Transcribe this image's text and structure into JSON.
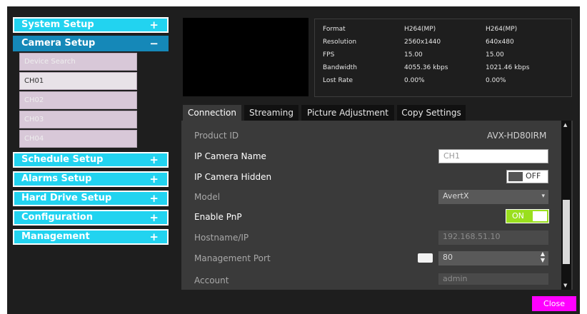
{
  "sidebar": {
    "sections": [
      {
        "label": "System Setup",
        "icon": "+"
      },
      {
        "label": "Camera Setup",
        "icon": "−"
      },
      {
        "label": "Schedule Setup",
        "icon": "+"
      },
      {
        "label": "Alarms Setup",
        "icon": "+"
      },
      {
        "label": "Hard Drive Setup",
        "icon": "+"
      },
      {
        "label": "Configuration",
        "icon": "+"
      },
      {
        "label": "Management",
        "icon": "+"
      }
    ],
    "camera_items": [
      "Device Search",
      "CH01",
      "CH02",
      "CH03",
      "CH04"
    ],
    "selected_item": "CH01"
  },
  "stats": {
    "rows": [
      {
        "label": "Format",
        "main": "H264(MP)",
        "sub": "H264(MP)"
      },
      {
        "label": "Resolution",
        "main": "2560x1440",
        "sub": "640x480"
      },
      {
        "label": "FPS",
        "main": "15.00",
        "sub": "15.00"
      },
      {
        "label": "Bandwidth",
        "main": "4055.36 kbps",
        "sub": "1021.46 kbps"
      },
      {
        "label": "Lost Rate",
        "main": "0.00%",
        "sub": "0.00%"
      }
    ]
  },
  "tabs": [
    "Connection",
    "Streaming",
    "Picture Adjustment",
    "Copy Settings"
  ],
  "active_tab": "Connection",
  "form": {
    "product_id_label": "Product ID",
    "product_id_value": "AVX-HD80IRM",
    "camera_name_label": "IP Camera Name",
    "camera_name_value": "CH1",
    "hidden_label": "IP Camera Hidden",
    "hidden_toggle": "OFF",
    "model_label": "Model",
    "model_value": "AvertX",
    "pnp_label": "Enable PnP",
    "pnp_toggle": "ON",
    "hostname_label": "Hostname/IP",
    "hostname_value": "192.168.51.10",
    "port_label": "Management Port",
    "port_value": "80",
    "account_label": "Account",
    "account_value": "admin"
  },
  "close_label": "Close",
  "colors": {
    "section": "#22d3f0",
    "active_section": "#1588b8",
    "toggle_on": "#9adf1e",
    "close": "#ff00ff"
  }
}
